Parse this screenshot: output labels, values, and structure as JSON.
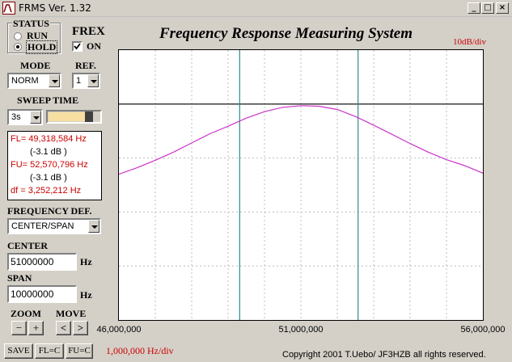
{
  "window": {
    "title": "FRMS   Ver. 1.32",
    "controls": {
      "minimize": "_",
      "maximize": "□",
      "close": "×"
    }
  },
  "header": {
    "title": "Frequency Response Measuring System",
    "scale_label": "10dB/div"
  },
  "status": {
    "group_label": "STATUS",
    "options": [
      {
        "label": "RUN",
        "selected": false
      },
      {
        "label": "HOLD",
        "selected": true
      }
    ]
  },
  "frex": {
    "label": "FREX",
    "checkbox_label": "ON",
    "checked": true
  },
  "mode": {
    "label": "MODE",
    "value": "NORM"
  },
  "ref": {
    "label": "REF.",
    "value": "1"
  },
  "sweep": {
    "label": "SWEEP TIME",
    "value": "3s",
    "progress": 0.72
  },
  "readout": {
    "fl": "FL= 49,318,584  Hz",
    "fl_db": "(-3.1 dB )",
    "fu": "FU= 52,570,796  Hz",
    "fu_db": "(-3.1 dB )",
    "df": "df = 3,252,212  Hz"
  },
  "freq_def": {
    "label": "FREQUENCY DEF.",
    "value": "CENTER/SPAN"
  },
  "center": {
    "label": "CENTER",
    "value": "51000000",
    "unit": "Hz"
  },
  "span": {
    "label": "SPAN",
    "value": "10000000",
    "unit": "Hz"
  },
  "zoom": {
    "label": "ZOOM",
    "minus": "−",
    "plus": "+"
  },
  "move": {
    "label": "MOVE",
    "left": "<",
    "right": ">"
  },
  "buttons": {
    "save": "SAVE",
    "fl_c": "FL=C",
    "fu_c": "FU=C"
  },
  "footer": {
    "hz_div": "1,000,000  Hz/div",
    "copyright": "Copyright 2001 T.Uebo/ JF3HZB all rights reserved."
  },
  "colors": {
    "trace": "#cc33cc",
    "markers": "#2e8b8b",
    "accent_red": "#cc0000"
  },
  "chart_data": {
    "type": "line",
    "x_tick_labels": [
      "46,000,000",
      "51,000,000",
      "56,000,000"
    ],
    "xlim": [
      46000000,
      56000000
    ],
    "ylim": [
      -50,
      0
    ],
    "grid": true,
    "reference_level_db": -10,
    "markers_hz": [
      49318584,
      52570796
    ],
    "series": [
      {
        "x": [
          46000000,
          46500000,
          47000000,
          47500000,
          48000000,
          48500000,
          49000000,
          49500000,
          50000000,
          50500000,
          51000000,
          51500000,
          52000000,
          52500000,
          53000000,
          53500000,
          54000000,
          54500000,
          55000000,
          55500000,
          56000000
        ],
        "y": [
          -23.0,
          -21.8,
          -20.4,
          -18.9,
          -17.2,
          -15.5,
          -14.1,
          -12.6,
          -11.4,
          -10.6,
          -10.3,
          -10.4,
          -11.0,
          -12.3,
          -13.9,
          -15.6,
          -17.3,
          -18.9,
          -20.3,
          -21.4,
          -22.8
        ]
      }
    ]
  }
}
